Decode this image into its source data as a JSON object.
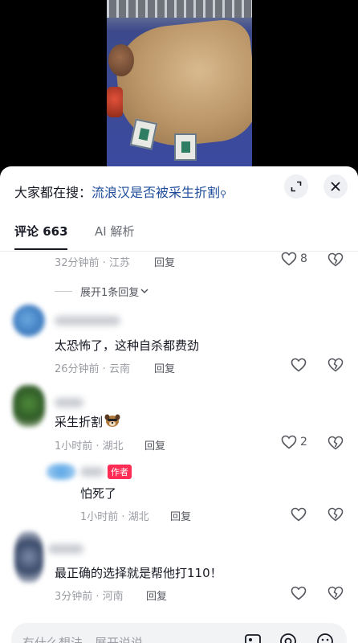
{
  "search": {
    "prefix": "大家都在搜：",
    "query": "流浪汉是否被采生折割",
    "query_icon": "search-icon"
  },
  "tabs": [
    {
      "label": "评论 663",
      "active": true
    },
    {
      "label": "AI 解析",
      "active": false
    }
  ],
  "comments": [
    {
      "id": "c0",
      "meta": "32分钟前 · 江苏",
      "reply_label": "回复",
      "likes": "8",
      "expand_label": "展开1条回复"
    },
    {
      "id": "c1",
      "text": "太恐怖了，这种自杀都费劲",
      "meta": "26分钟前 · 云南",
      "reply_label": "回复",
      "likes": ""
    },
    {
      "id": "c2",
      "text": "采生折割",
      "emoji": "dog-emoji",
      "meta": "1小时前 · 湖北",
      "reply_label": "回复",
      "likes": "2"
    },
    {
      "id": "c2r",
      "badge": "作者",
      "text": "怕死了",
      "meta": "1小时前 · 湖北",
      "reply_label": "回复",
      "likes": ""
    },
    {
      "id": "c3",
      "text": "最正确的选择就是帮他打110！",
      "meta": "3分钟前 · 河南",
      "reply_label": "回复",
      "likes": ""
    }
  ],
  "input": {
    "placeholder": "有什么想法，展开说说",
    "icons": [
      "image-icon",
      "at-icon",
      "emoji-icon"
    ]
  },
  "colors": {
    "link": "#1e4c9a",
    "author_badge": "#fe2c55",
    "meta": "#9a9ca3"
  }
}
